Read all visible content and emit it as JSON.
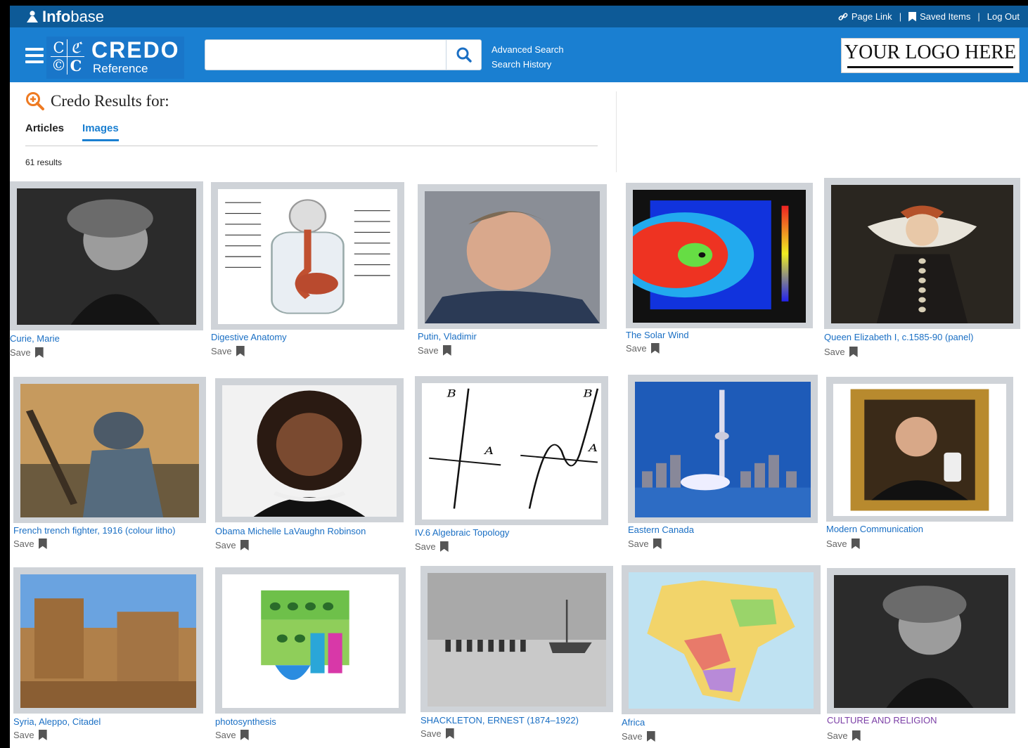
{
  "topbar": {
    "brand_bold": "Info",
    "brand_light": "base",
    "page_link": "Page Link",
    "saved_items": "Saved Items",
    "log_out": "Log Out",
    "sep": "|"
  },
  "header": {
    "credo_word": "CREDO",
    "credo_sub": "Reference",
    "grid": [
      "C",
      "ℭ",
      "©",
      "C"
    ],
    "search_value": "",
    "advanced_search": "Advanced Search",
    "search_history": "Search History",
    "your_logo": "YOUR LOGO HERE"
  },
  "results": {
    "heading": "Credo Results for:",
    "tabs": [
      "Articles",
      "Images"
    ],
    "active_tab": "Images",
    "count": "61 results",
    "save_label": "Save",
    "items": [
      {
        "title": "Curie, Marie",
        "icon": "portrait-bw"
      },
      {
        "title": "Digestive Anatomy",
        "icon": "anatomy-diagram"
      },
      {
        "title": "Putin, Vladimir",
        "icon": "portrait-color"
      },
      {
        "title": "The Solar Wind",
        "icon": "heatmap-plot"
      },
      {
        "title": "Queen Elizabeth I, c.1585-90 (panel)",
        "icon": "painting-portrait"
      },
      {
        "title": "French trench fighter, 1916 (colour litho)",
        "icon": "lithograph"
      },
      {
        "title": "Obama Michelle LaVaughn Robinson",
        "icon": "portrait-color"
      },
      {
        "title": "IV.6 Algebraic Topology",
        "icon": "math-graph"
      },
      {
        "title": "Eastern Canada",
        "icon": "city-skyline"
      },
      {
        "title": "Modern Communication",
        "icon": "framed-portrait"
      },
      {
        "title": "Syria, Aleppo, Citadel",
        "icon": "fortress-photo"
      },
      {
        "title": "photosynthesis",
        "icon": "leaf-diagram"
      },
      {
        "title": "SHACKLETON, ERNEST (1874–1922)",
        "icon": "expedition-photo"
      },
      {
        "title": "Africa",
        "icon": "map"
      },
      {
        "title": "CULTURE AND RELIGION",
        "icon": "portrait-bw"
      }
    ]
  },
  "colors": {
    "topbar": "#0d5a97",
    "header": "#1a7fd1",
    "link": "#1a6fc4",
    "visited_link": "#7b3fa6",
    "thumb_bg": "#cfd3d8"
  }
}
